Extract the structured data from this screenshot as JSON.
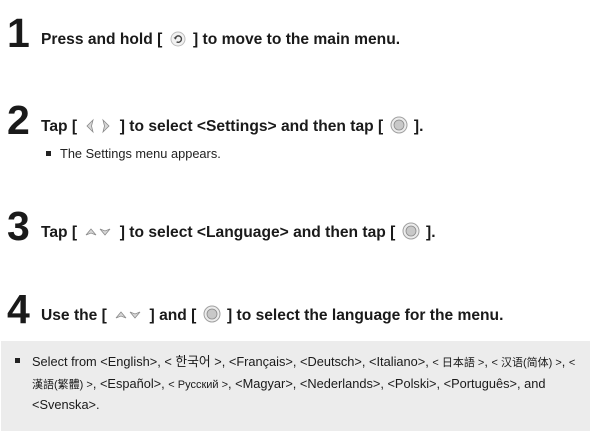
{
  "steps": [
    {
      "number": "1",
      "parts": [
        "Press and hold [",
        "] to move to the main menu."
      ],
      "icons": [
        "back-icon"
      ]
    },
    {
      "number": "2",
      "parts": [
        "Tap [",
        "] to select <Settings> and then tap [",
        "]."
      ],
      "icons": [
        "left-right-icon",
        "select-button-icon"
      ],
      "note": "The Settings menu appears."
    },
    {
      "number": "3",
      "parts": [
        "Tap [",
        "] to select <Language> and then tap [",
        "]."
      ],
      "icons": [
        "up-down-icon",
        "select-button-icon"
      ]
    },
    {
      "number": "4",
      "parts": [
        "Use the [",
        "] and [",
        "] to select the language for the menu."
      ],
      "icons": [
        "up-down-icon",
        "select-button-icon"
      ]
    }
  ],
  "languages": {
    "intro": "Select from ",
    "items": [
      "<English>",
      "< 한국어 >",
      "<Français>",
      "<Deutsch>",
      "<Italiano>",
      "< 日本語 >",
      "< 汉语(简体) >",
      "< 漢語(繁體) >",
      "<Español>",
      "< Русский >",
      "<Magyar>",
      "<Nederlands>",
      "<Polski>",
      "<Português>"
    ],
    "conjunction": "and",
    "last": "<Svenska>",
    "ending": "."
  }
}
